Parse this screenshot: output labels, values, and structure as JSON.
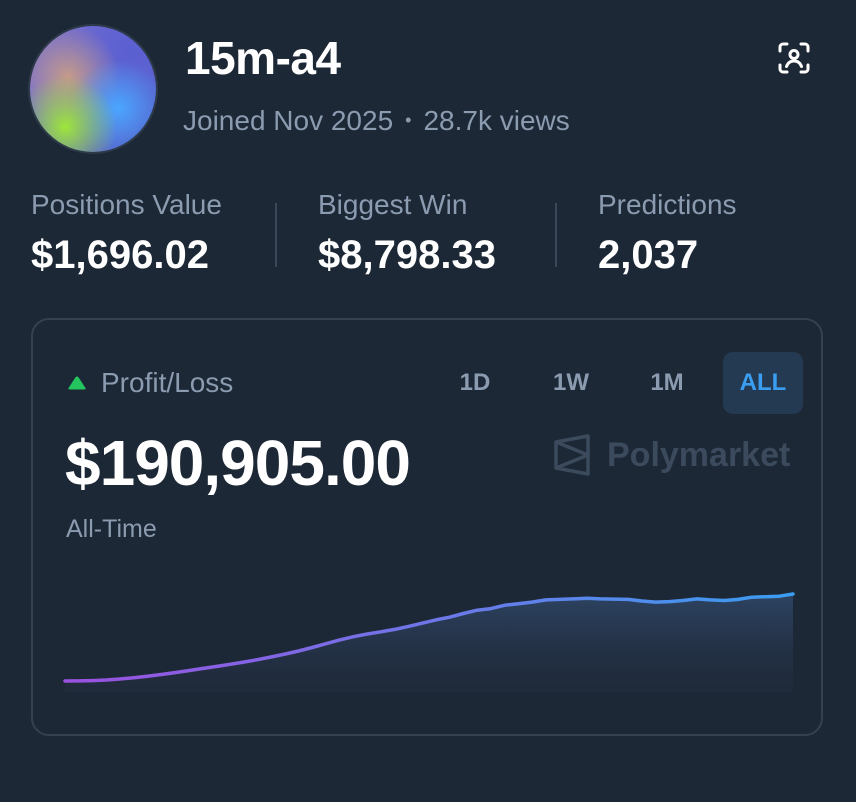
{
  "profile": {
    "username": "15m-a4",
    "joined": "Joined Nov 2025",
    "separator": "•",
    "views": "28.7k views",
    "scan_icon": "face-scan-icon"
  },
  "stats": [
    {
      "label": "Positions Value",
      "value": "$1,696.02"
    },
    {
      "label": "Biggest Win",
      "value": "$8,798.33"
    },
    {
      "label": "Predictions",
      "value": "2,037"
    }
  ],
  "card": {
    "title": "Profit/Loss",
    "indicator_icon": "up-triangle-icon",
    "indicator_color": "#22c55e",
    "tabs": [
      {
        "label": "1D",
        "active": false
      },
      {
        "label": "1W",
        "active": false
      },
      {
        "label": "1M",
        "active": false
      },
      {
        "label": "ALL",
        "active": true
      }
    ],
    "value": "$190,905.00",
    "period": "All-Time",
    "brand": "Polymarket"
  },
  "colors": {
    "background": "#1d2836",
    "accent": "#3a9df0",
    "muted_text": "#8b9bb0",
    "line_start": "#9b51e0",
    "line_end": "#3a9df0"
  },
  "chart_data": {
    "type": "line",
    "title": "",
    "xlabel": "",
    "ylabel": "",
    "series": [
      {
        "values": [
          0,
          200,
          700,
          1900,
          3700,
          6100,
          8900,
          12000,
          15600,
          19300,
          23100,
          26900,
          30800,
          35000,
          39500,
          44500,
          49800,
          55500,
          62000,
          69000,
          76000,
          82000,
          87000,
          91000,
          95500,
          101000,
          107000,
          113000,
          118000,
          125000,
          131000,
          134000,
          140000,
          143000,
          146000,
          150000,
          151000,
          152000,
          153000,
          152000,
          151500,
          151000,
          148000,
          146000,
          147000,
          149000,
          152000,
          150000,
          149000,
          151000,
          155000,
          156000,
          157000,
          161000
        ]
      }
    ],
    "grid": false,
    "legend": "none"
  }
}
